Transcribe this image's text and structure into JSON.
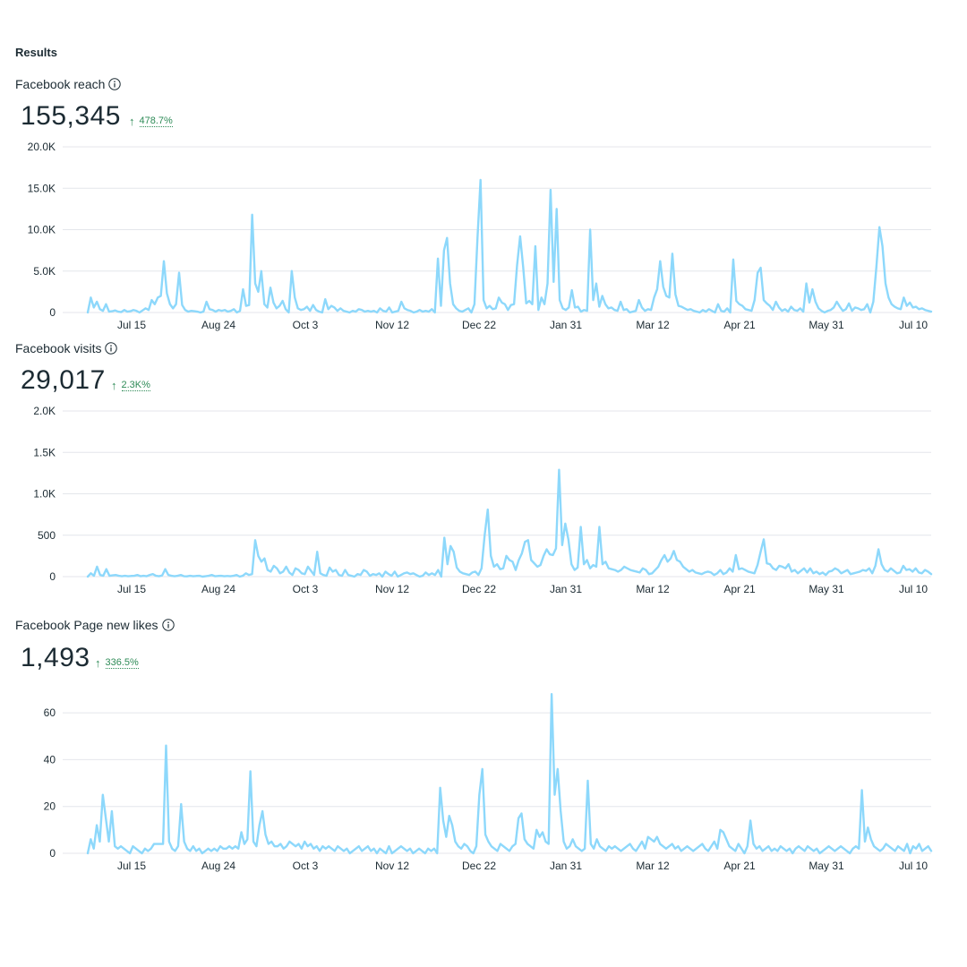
{
  "section_title": "Results",
  "metrics": [
    {
      "title": "Facebook reach",
      "value": "155,345",
      "change": "478.7%",
      "arrow": "↑"
    },
    {
      "title": "Facebook visits",
      "value": "29,017",
      "change": "2.3K%",
      "arrow": "↑"
    },
    {
      "title": "Facebook Page new likes",
      "value": "1,493",
      "change": "336.5%",
      "arrow": "↑"
    }
  ],
  "colors": {
    "line": "#8dd8fb",
    "positive": "#2e8b57",
    "grid": "#e4e6eb",
    "text": "#1c2b33"
  },
  "chart_data": [
    {
      "type": "line",
      "title": "Facebook reach",
      "x_tick_labels": [
        "Jul 15",
        "Aug 24",
        "Oct 3",
        "Nov 12",
        "Dec 22",
        "Jan 31",
        "Mar 12",
        "Apr 21",
        "May 31",
        "Jul 10"
      ],
      "y_tick_labels": [
        "0",
        "5.0K",
        "10.0K",
        "15.0K",
        "20.0K"
      ],
      "ylim": [
        0,
        20000
      ],
      "grid": true,
      "series": [
        {
          "values": [
            0,
            1800,
            600,
            1300,
            400,
            200,
            1000,
            100,
            150,
            250,
            100,
            50,
            300,
            100,
            150,
            300,
            200,
            0,
            250,
            500,
            300,
            1500,
            1000,
            1800,
            2000,
            6200,
            2300,
            1000,
            500,
            1000,
            4800,
            900,
            300,
            100,
            200,
            150,
            100,
            0,
            100,
            1300,
            400,
            300,
            100,
            300,
            200,
            300,
            100,
            200,
            400,
            0,
            200,
            2800,
            800,
            900,
            11800,
            3500,
            2500,
            5000,
            1000,
            600,
            3000,
            1200,
            500,
            800,
            1400,
            400,
            0,
            5000,
            1800,
            500,
            300,
            400,
            700,
            200,
            900,
            300,
            100,
            0,
            1600,
            400,
            800,
            600,
            200,
            500,
            200,
            100,
            0,
            200,
            100,
            400,
            300,
            100,
            200,
            100,
            200,
            0,
            500,
            200,
            100,
            600,
            0,
            100,
            200,
            1300,
            500,
            300,
            200,
            0,
            100,
            300,
            100,
            200,
            100,
            400,
            0,
            6500,
            800,
            7500,
            9000,
            3500,
            1000,
            500,
            200,
            100,
            300,
            500,
            0,
            1000,
            9000,
            16000,
            1500,
            500,
            800,
            400,
            500,
            1800,
            1200,
            1000,
            300,
            900,
            1000,
            5700,
            9200,
            5500,
            1100,
            1400,
            1000,
            8000,
            300,
            1800,
            1000,
            3500,
            14800,
            3700,
            12500,
            1500,
            500,
            300,
            600,
            2700,
            600,
            700,
            100,
            300,
            200,
            10000,
            1500,
            3500,
            700,
            2000,
            1000,
            500,
            600,
            300,
            200,
            1300,
            300,
            400,
            0,
            100,
            200,
            1500,
            600,
            200,
            400,
            300,
            1800,
            2800,
            6200,
            3100,
            2000,
            1800,
            7100,
            2200,
            800,
            700,
            500,
            300,
            400,
            200,
            100,
            0,
            300,
            100,
            400,
            200,
            0,
            1000,
            200,
            100,
            500,
            0,
            6400,
            1400,
            1000,
            800,
            400,
            300,
            200,
            1500,
            4800,
            5400,
            1500,
            1100,
            800,
            300,
            1300,
            600,
            200,
            400,
            100,
            700,
            300,
            200,
            500,
            100,
            3500,
            1200,
            2800,
            1300,
            500,
            200,
            0,
            200,
            300,
            600,
            1300,
            700,
            200,
            400,
            1100,
            200,
            600,
            500,
            300,
            400,
            1000,
            0,
            1300,
            5500,
            10300,
            8000,
            3500,
            1800,
            1000,
            700,
            500,
            400,
            1800,
            800,
            1200,
            600,
            700,
            400,
            500,
            300,
            200,
            100
          ]
        }
      ]
    },
    {
      "type": "line",
      "title": "Facebook visits",
      "x_tick_labels": [
        "Jul 15",
        "Aug 24",
        "Oct 3",
        "Nov 12",
        "Dec 22",
        "Jan 31",
        "Mar 12",
        "Apr 21",
        "May 31",
        "Jul 10"
      ],
      "y_tick_labels": [
        "0",
        "500",
        "1.0K",
        "1.5K",
        "2.0K"
      ],
      "ylim": [
        0,
        2000
      ],
      "grid": true,
      "series": [
        {
          "values": [
            0,
            40,
            10,
            120,
            20,
            10,
            90,
            10,
            15,
            20,
            10,
            5,
            10,
            5,
            8,
            10,
            20,
            5,
            10,
            5,
            20,
            30,
            10,
            5,
            15,
            90,
            20,
            10,
            5,
            10,
            20,
            5,
            3,
            10,
            5,
            8,
            10,
            0,
            5,
            10,
            20,
            5,
            8,
            10,
            5,
            8,
            5,
            10,
            20,
            0,
            10,
            40,
            20,
            30,
            440,
            250,
            180,
            220,
            80,
            60,
            130,
            100,
            40,
            60,
            120,
            50,
            20,
            100,
            80,
            40,
            30,
            120,
            70,
            20,
            300,
            40,
            20,
            10,
            110,
            60,
            80,
            20,
            10,
            80,
            20,
            10,
            0,
            30,
            20,
            80,
            60,
            10,
            30,
            20,
            40,
            0,
            60,
            30,
            10,
            60,
            0,
            20,
            40,
            50,
            30,
            40,
            20,
            0,
            10,
            50,
            20,
            40,
            20,
            80,
            0,
            470,
            150,
            370,
            300,
            110,
            60,
            40,
            30,
            20,
            50,
            60,
            20,
            100,
            500,
            810,
            250,
            120,
            150,
            90,
            100,
            250,
            200,
            180,
            80,
            200,
            280,
            420,
            440,
            200,
            160,
            120,
            140,
            250,
            330,
            270,
            260,
            340,
            1290,
            380,
            640,
            450,
            150,
            80,
            110,
            600,
            150,
            200,
            100,
            140,
            120,
            600,
            150,
            180,
            100,
            90,
            80,
            60,
            80,
            120,
            100,
            80,
            70,
            60,
            50,
            100,
            80,
            30,
            40,
            80,
            120,
            200,
            260,
            180,
            220,
            310,
            200,
            180,
            120,
            90,
            60,
            80,
            50,
            40,
            30,
            50,
            60,
            50,
            20,
            40,
            80,
            30,
            50,
            100,
            60,
            260,
            90,
            100,
            80,
            60,
            50,
            40,
            140,
            300,
            450,
            160,
            150,
            100,
            80,
            130,
            120,
            100,
            150,
            60,
            80,
            40,
            70,
            100,
            50,
            100,
            40,
            60,
            30,
            50,
            20,
            60,
            70,
            100,
            80,
            40,
            60,
            80,
            30,
            40,
            50,
            60,
            80,
            70,
            100,
            40,
            130,
            330,
            150,
            80,
            60,
            100,
            70,
            40,
            50,
            130,
            80,
            90,
            60,
            100,
            50,
            40,
            80,
            60,
            30
          ]
        }
      ]
    },
    {
      "type": "line",
      "title": "Facebook Page new likes",
      "x_tick_labels": [
        "Jul 15",
        "Aug 24",
        "Oct 3",
        "Nov 12",
        "Dec 22",
        "Jan 31",
        "Mar 12",
        "Apr 21",
        "May 31",
        "Jul 10"
      ],
      "y_tick_labels": [
        "0",
        "20",
        "40",
        "60"
      ],
      "ylim": [
        0,
        70
      ],
      "grid": true,
      "series": [
        {
          "values": [
            0,
            6,
            2,
            12,
            5,
            25,
            15,
            5,
            18,
            3,
            2,
            3,
            2,
            1,
            0,
            3,
            2,
            1,
            0,
            2,
            1,
            2,
            4,
            4,
            4,
            4,
            46,
            5,
            2,
            1,
            3,
            21,
            5,
            2,
            1,
            3,
            1,
            2,
            0,
            1,
            2,
            1,
            2,
            1,
            3,
            2,
            2,
            3,
            2,
            3,
            2,
            9,
            4,
            6,
            35,
            5,
            3,
            12,
            18,
            8,
            4,
            5,
            3,
            3,
            4,
            2,
            3,
            5,
            4,
            3,
            4,
            2,
            5,
            3,
            4,
            2,
            3,
            1,
            3,
            2,
            3,
            2,
            1,
            3,
            2,
            1,
            2,
            0,
            1,
            2,
            3,
            1,
            2,
            3,
            1,
            2,
            0,
            2,
            1,
            0,
            3,
            0,
            1,
            2,
            3,
            2,
            1,
            2,
            0,
            1,
            2,
            1,
            0,
            2,
            1,
            2,
            0,
            28,
            14,
            7,
            16,
            12,
            5,
            3,
            2,
            4,
            3,
            1,
            0,
            3,
            25,
            36,
            8,
            5,
            3,
            2,
            1,
            4,
            3,
            2,
            1,
            3,
            4,
            15,
            17,
            6,
            4,
            3,
            2,
            10,
            7,
            9,
            5,
            4,
            68,
            25,
            36,
            18,
            5,
            2,
            3,
            6,
            3,
            2,
            1,
            2,
            31,
            4,
            2,
            6,
            3,
            2,
            1,
            3,
            2,
            3,
            2,
            1,
            2,
            3,
            4,
            2,
            1,
            3,
            5,
            2,
            7,
            6,
            5,
            7,
            4,
            3,
            2,
            3,
            4,
            2,
            3,
            1,
            2,
            3,
            2,
            1,
            2,
            3,
            4,
            2,
            1,
            3,
            5,
            2,
            10,
            9,
            6,
            3,
            2,
            1,
            4,
            2,
            0,
            3,
            14,
            4,
            2,
            3,
            1,
            2,
            3,
            1,
            2,
            1,
            3,
            2,
            1,
            2,
            0,
            2,
            3,
            2,
            1,
            3,
            2,
            1,
            2,
            0,
            1,
            2,
            3,
            2,
            1,
            2,
            3,
            2,
            1,
            0,
            2,
            3,
            2,
            27,
            5,
            11,
            6,
            3,
            2,
            1,
            2,
            4,
            3,
            2,
            1,
            3,
            2,
            1,
            4,
            0,
            3,
            2,
            4,
            1,
            2,
            3,
            1
          ]
        }
      ]
    }
  ]
}
